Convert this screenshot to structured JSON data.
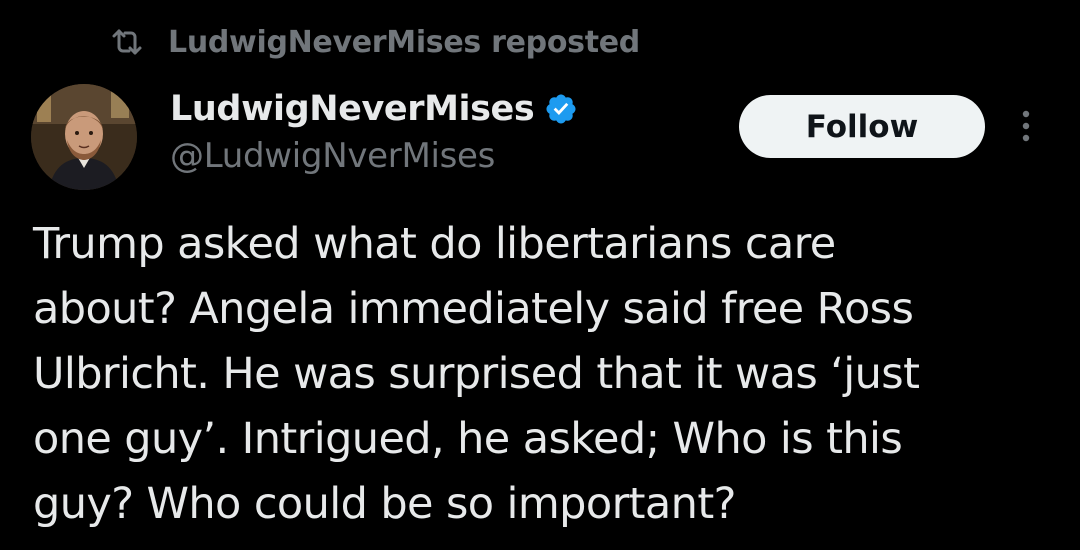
{
  "repost": {
    "icon": "repost-icon",
    "text": "LudwigNeverMises reposted"
  },
  "author": {
    "avatar": "avatar-photo",
    "display_name": "LudwigNeverMises",
    "verified_icon": "verified-badge-icon",
    "handle": "@LudwigNverMises"
  },
  "actions": {
    "follow_label": "Follow",
    "more_icon": "more-options-icon"
  },
  "tweet": {
    "lines": [
      "Trump asked what do libertarians care",
      "about? Angela immediately said free Ross",
      "Ulbricht. He was surprised that it was ‘just",
      "one guy’. Intrigued, he asked; Who is this",
      "guy? Who could be so important?"
    ]
  },
  "colors": {
    "background": "#000000",
    "primary_text": "#e7e9ea",
    "secondary_text": "#71767b",
    "verified_blue": "#1d9bf0",
    "follow_button_bg": "#eff3f4",
    "follow_button_text": "#0f1419"
  }
}
